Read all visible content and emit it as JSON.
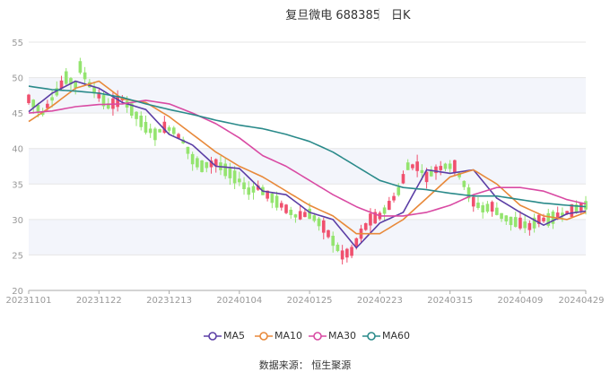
{
  "header": {
    "stock": "复旦微电 688385",
    "period": "日K"
  },
  "source": "数据来源： 恒生聚源",
  "colors": {
    "up": "#f0506e",
    "down": "#94e46f",
    "ma5": "#5b3ea5",
    "ma10": "#e8893a",
    "ma30": "#d94aa3",
    "ma60": "#2a8a8a",
    "band": "#f3f5fb",
    "axis": "#999999"
  },
  "chart_data": {
    "type": "candlestick",
    "title": "复旦微电 688385  日K",
    "ylim": [
      20,
      55
    ],
    "yticks": [
      20,
      25,
      30,
      35,
      40,
      45,
      50,
      55
    ],
    "x_tick_labels": [
      "20231101",
      "20231122",
      "20231213",
      "20240104",
      "20240125",
      "20240223",
      "20240315",
      "20240409",
      "20240429"
    ],
    "x_tick_index": [
      0,
      15,
      30,
      45,
      60,
      75,
      90,
      105,
      119
    ],
    "n": 120,
    "series": [
      {
        "name": "MA5",
        "color": "#5b3ea5",
        "points": [
          [
            0,
            45.2
          ],
          [
            5,
            47.8
          ],
          [
            10,
            49.5
          ],
          [
            15,
            48.5
          ],
          [
            20,
            46.5
          ],
          [
            25,
            45.5
          ],
          [
            30,
            42.0
          ],
          [
            35,
            40.5
          ],
          [
            40,
            37.5
          ],
          [
            45,
            37.2
          ],
          [
            50,
            34.0
          ],
          [
            55,
            33.5
          ],
          [
            60,
            31.0
          ],
          [
            65,
            30.0
          ],
          [
            70,
            26.0
          ],
          [
            75,
            29.5
          ],
          [
            80,
            31.0
          ],
          [
            85,
            37.0
          ],
          [
            90,
            36.5
          ],
          [
            95,
            37.0
          ],
          [
            100,
            33.0
          ],
          [
            105,
            31.0
          ],
          [
            110,
            29.2
          ],
          [
            115,
            30.8
          ],
          [
            119,
            31.2
          ]
        ]
      },
      {
        "name": "MA10",
        "color": "#e8893a",
        "points": [
          [
            0,
            43.8
          ],
          [
            5,
            46.0
          ],
          [
            10,
            48.5
          ],
          [
            15,
            49.5
          ],
          [
            20,
            47.0
          ],
          [
            25,
            46.5
          ],
          [
            30,
            44.5
          ],
          [
            35,
            42.0
          ],
          [
            40,
            39.5
          ],
          [
            45,
            37.5
          ],
          [
            50,
            36.0
          ],
          [
            55,
            34.0
          ],
          [
            60,
            32.0
          ],
          [
            65,
            30.5
          ],
          [
            70,
            28.0
          ],
          [
            75,
            28.0
          ],
          [
            80,
            30.0
          ],
          [
            85,
            33.0
          ],
          [
            90,
            36.0
          ],
          [
            95,
            37.0
          ],
          [
            100,
            35.0
          ],
          [
            105,
            32.0
          ],
          [
            110,
            30.5
          ],
          [
            115,
            30.0
          ],
          [
            119,
            31.0
          ]
        ]
      },
      {
        "name": "MA30",
        "color": "#d94aa3",
        "points": [
          [
            0,
            45.0
          ],
          [
            5,
            45.3
          ],
          [
            10,
            45.9
          ],
          [
            15,
            46.2
          ],
          [
            20,
            46.3
          ],
          [
            25,
            46.8
          ],
          [
            30,
            46.3
          ],
          [
            35,
            45.0
          ],
          [
            40,
            43.5
          ],
          [
            45,
            41.5
          ],
          [
            50,
            39.0
          ],
          [
            55,
            37.5
          ],
          [
            60,
            35.5
          ],
          [
            65,
            33.5
          ],
          [
            70,
            31.8
          ],
          [
            75,
            30.5
          ],
          [
            80,
            30.5
          ],
          [
            85,
            31.0
          ],
          [
            90,
            32.0
          ],
          [
            95,
            33.5
          ],
          [
            100,
            34.5
          ],
          [
            105,
            34.5
          ],
          [
            110,
            34.0
          ],
          [
            115,
            32.8
          ],
          [
            119,
            32.2
          ]
        ]
      },
      {
        "name": "MA60",
        "color": "#2a8a8a",
        "points": [
          [
            0,
            48.8
          ],
          [
            5,
            48.3
          ],
          [
            10,
            48.1
          ],
          [
            15,
            47.8
          ],
          [
            20,
            47.2
          ],
          [
            25,
            46.3
          ],
          [
            30,
            45.5
          ],
          [
            35,
            44.8
          ],
          [
            40,
            44.0
          ],
          [
            45,
            43.3
          ],
          [
            50,
            42.8
          ],
          [
            55,
            42.0
          ],
          [
            60,
            41.0
          ],
          [
            65,
            39.5
          ],
          [
            70,
            37.5
          ],
          [
            75,
            35.5
          ],
          [
            80,
            34.5
          ],
          [
            85,
            34.2
          ],
          [
            90,
            33.7
          ],
          [
            95,
            33.3
          ],
          [
            100,
            33.3
          ],
          [
            105,
            32.8
          ],
          [
            110,
            32.3
          ],
          [
            115,
            32.0
          ],
          [
            119,
            31.8
          ]
        ]
      }
    ],
    "candle_knots": [
      [
        0,
        47.0
      ],
      [
        3,
        45.0
      ],
      [
        6,
        48.0
      ],
      [
        8,
        50.0
      ],
      [
        10,
        49.0
      ],
      [
        11,
        51.5
      ],
      [
        13,
        49.0
      ],
      [
        15,
        47.5
      ],
      [
        17,
        46.0
      ],
      [
        20,
        47.0
      ],
      [
        22,
        45.5
      ],
      [
        25,
        43.0
      ],
      [
        27,
        42.0
      ],
      [
        29,
        43.0
      ],
      [
        31,
        42.5
      ],
      [
        33,
        41.0
      ],
      [
        35,
        38.5
      ],
      [
        37,
        37.5
      ],
      [
        40,
        38.0
      ],
      [
        42,
        37.0
      ],
      [
        45,
        35.5
      ],
      [
        47,
        34.0
      ],
      [
        49,
        34.5
      ],
      [
        52,
        33.0
      ],
      [
        55,
        31.5
      ],
      [
        57,
        30.5
      ],
      [
        60,
        30.8
      ],
      [
        63,
        29.0
      ],
      [
        65,
        27.0
      ],
      [
        67,
        25.0
      ],
      [
        69,
        25.5
      ],
      [
        71,
        28.0
      ],
      [
        73,
        30.0
      ],
      [
        75,
        30.5
      ],
      [
        77,
        32.0
      ],
      [
        79,
        34.0
      ],
      [
        81,
        37.5
      ],
      [
        83,
        37.5
      ],
      [
        85,
        36.0
      ],
      [
        87,
        37.0
      ],
      [
        89,
        37.5
      ],
      [
        91,
        37.5
      ],
      [
        93,
        35.0
      ],
      [
        95,
        32.5
      ],
      [
        97,
        31.5
      ],
      [
        99,
        31.8
      ],
      [
        101,
        30.5
      ],
      [
        103,
        29.8
      ],
      [
        105,
        29.5
      ],
      [
        107,
        29.0
      ],
      [
        109,
        30.0
      ],
      [
        111,
        30.0
      ],
      [
        113,
        30.5
      ],
      [
        115,
        31.0
      ],
      [
        117,
        31.5
      ],
      [
        119,
        32.0
      ]
    ]
  },
  "legend": [
    {
      "name": "MA5"
    },
    {
      "name": "MA10"
    },
    {
      "name": "MA30"
    },
    {
      "name": "MA60"
    }
  ]
}
